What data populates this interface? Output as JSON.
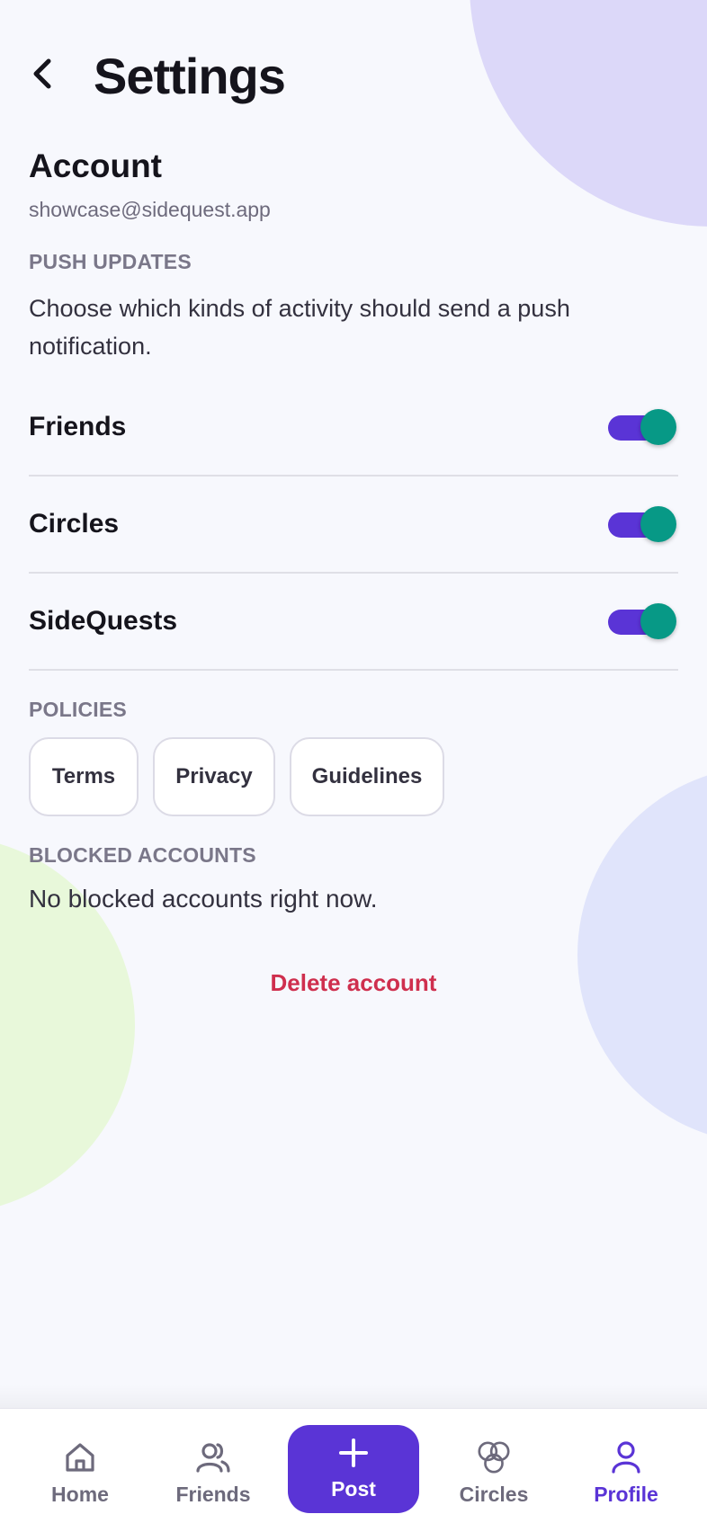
{
  "header": {
    "title": "Settings",
    "back_icon": "chevron-left-icon"
  },
  "account": {
    "title": "Account",
    "email": "showcase@sidequest.app"
  },
  "push": {
    "section_label": "PUSH UPDATES",
    "description": "Choose which kinds of activity should send a push notification.",
    "toggles": [
      {
        "label": "Friends",
        "on": true
      },
      {
        "label": "Circles",
        "on": true
      },
      {
        "label": "SideQuests",
        "on": true
      }
    ]
  },
  "policies": {
    "section_label": "POLICIES",
    "buttons": [
      "Terms",
      "Privacy",
      "Guidelines"
    ]
  },
  "blocked": {
    "section_label": "BLOCKED ACCOUNTS",
    "empty_text": "No blocked accounts right now."
  },
  "delete_label": "Delete account",
  "nav": {
    "items": [
      {
        "label": "Home",
        "icon": "home-icon"
      },
      {
        "label": "Friends",
        "icon": "friends-icon"
      },
      {
        "label": "Post",
        "icon": "plus-icon"
      },
      {
        "label": "Circles",
        "icon": "circles-icon"
      },
      {
        "label": "Profile",
        "icon": "profile-icon",
        "active": true
      }
    ]
  },
  "colors": {
    "accent": "#5a34d6",
    "toggle_knob": "#079986",
    "danger": "#cf2f4e",
    "background": "#f7f8fd"
  }
}
